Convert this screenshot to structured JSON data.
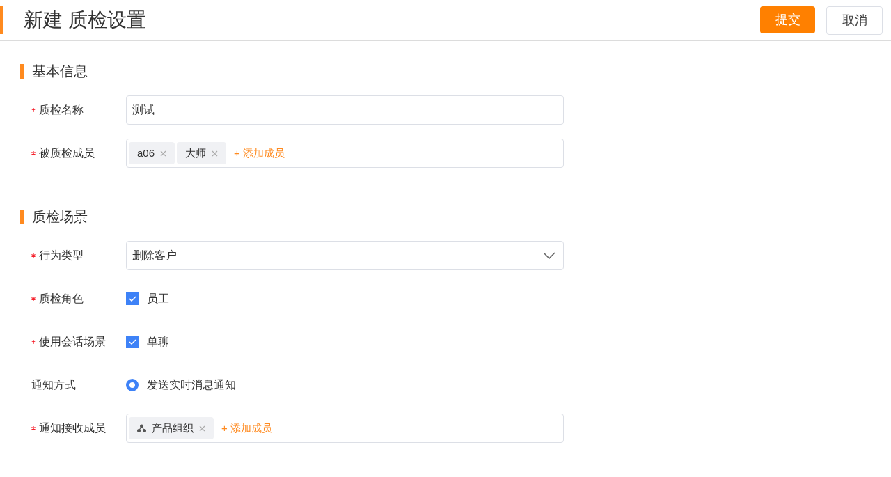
{
  "header": {
    "title": "新建 质检设置",
    "buttons": [
      {
        "label": "提交",
        "kind": "primary"
      },
      {
        "label": "取消",
        "kind": "default"
      }
    ]
  },
  "sections": [
    {
      "title": "基本信息",
      "fields": [
        {
          "label": "质检名称",
          "required": true,
          "kind": "text",
          "value": "测试"
        },
        {
          "label": "被质检成员",
          "required": true,
          "kind": "tags",
          "tags": [
            {
              "label": "a06",
              "kind": "person"
            },
            {
              "label": "大师",
              "kind": "person"
            }
          ],
          "add_label": "+ 添加成员"
        }
      ]
    },
    {
      "title": "质检场景",
      "fields": [
        {
          "label": "行为类型",
          "required": true,
          "kind": "select",
          "value": "删除客户"
        },
        {
          "label": "质检角色",
          "required": true,
          "kind": "checkbox",
          "options": [
            {
              "label": "员工",
              "checked": true
            }
          ]
        },
        {
          "label": "使用会话场景",
          "required": true,
          "kind": "checkbox",
          "options": [
            {
              "label": "单聊",
              "checked": true
            }
          ]
        },
        {
          "label": "通知方式",
          "required": false,
          "kind": "radio",
          "options": [
            {
              "label": "发送实时消息通知",
              "selected": true
            }
          ]
        },
        {
          "label": "通知接收成员",
          "required": true,
          "kind": "tags",
          "tags": [
            {
              "label": "产品组织",
              "kind": "org"
            }
          ],
          "add_label": "+ 添加成员"
        }
      ]
    }
  ]
}
